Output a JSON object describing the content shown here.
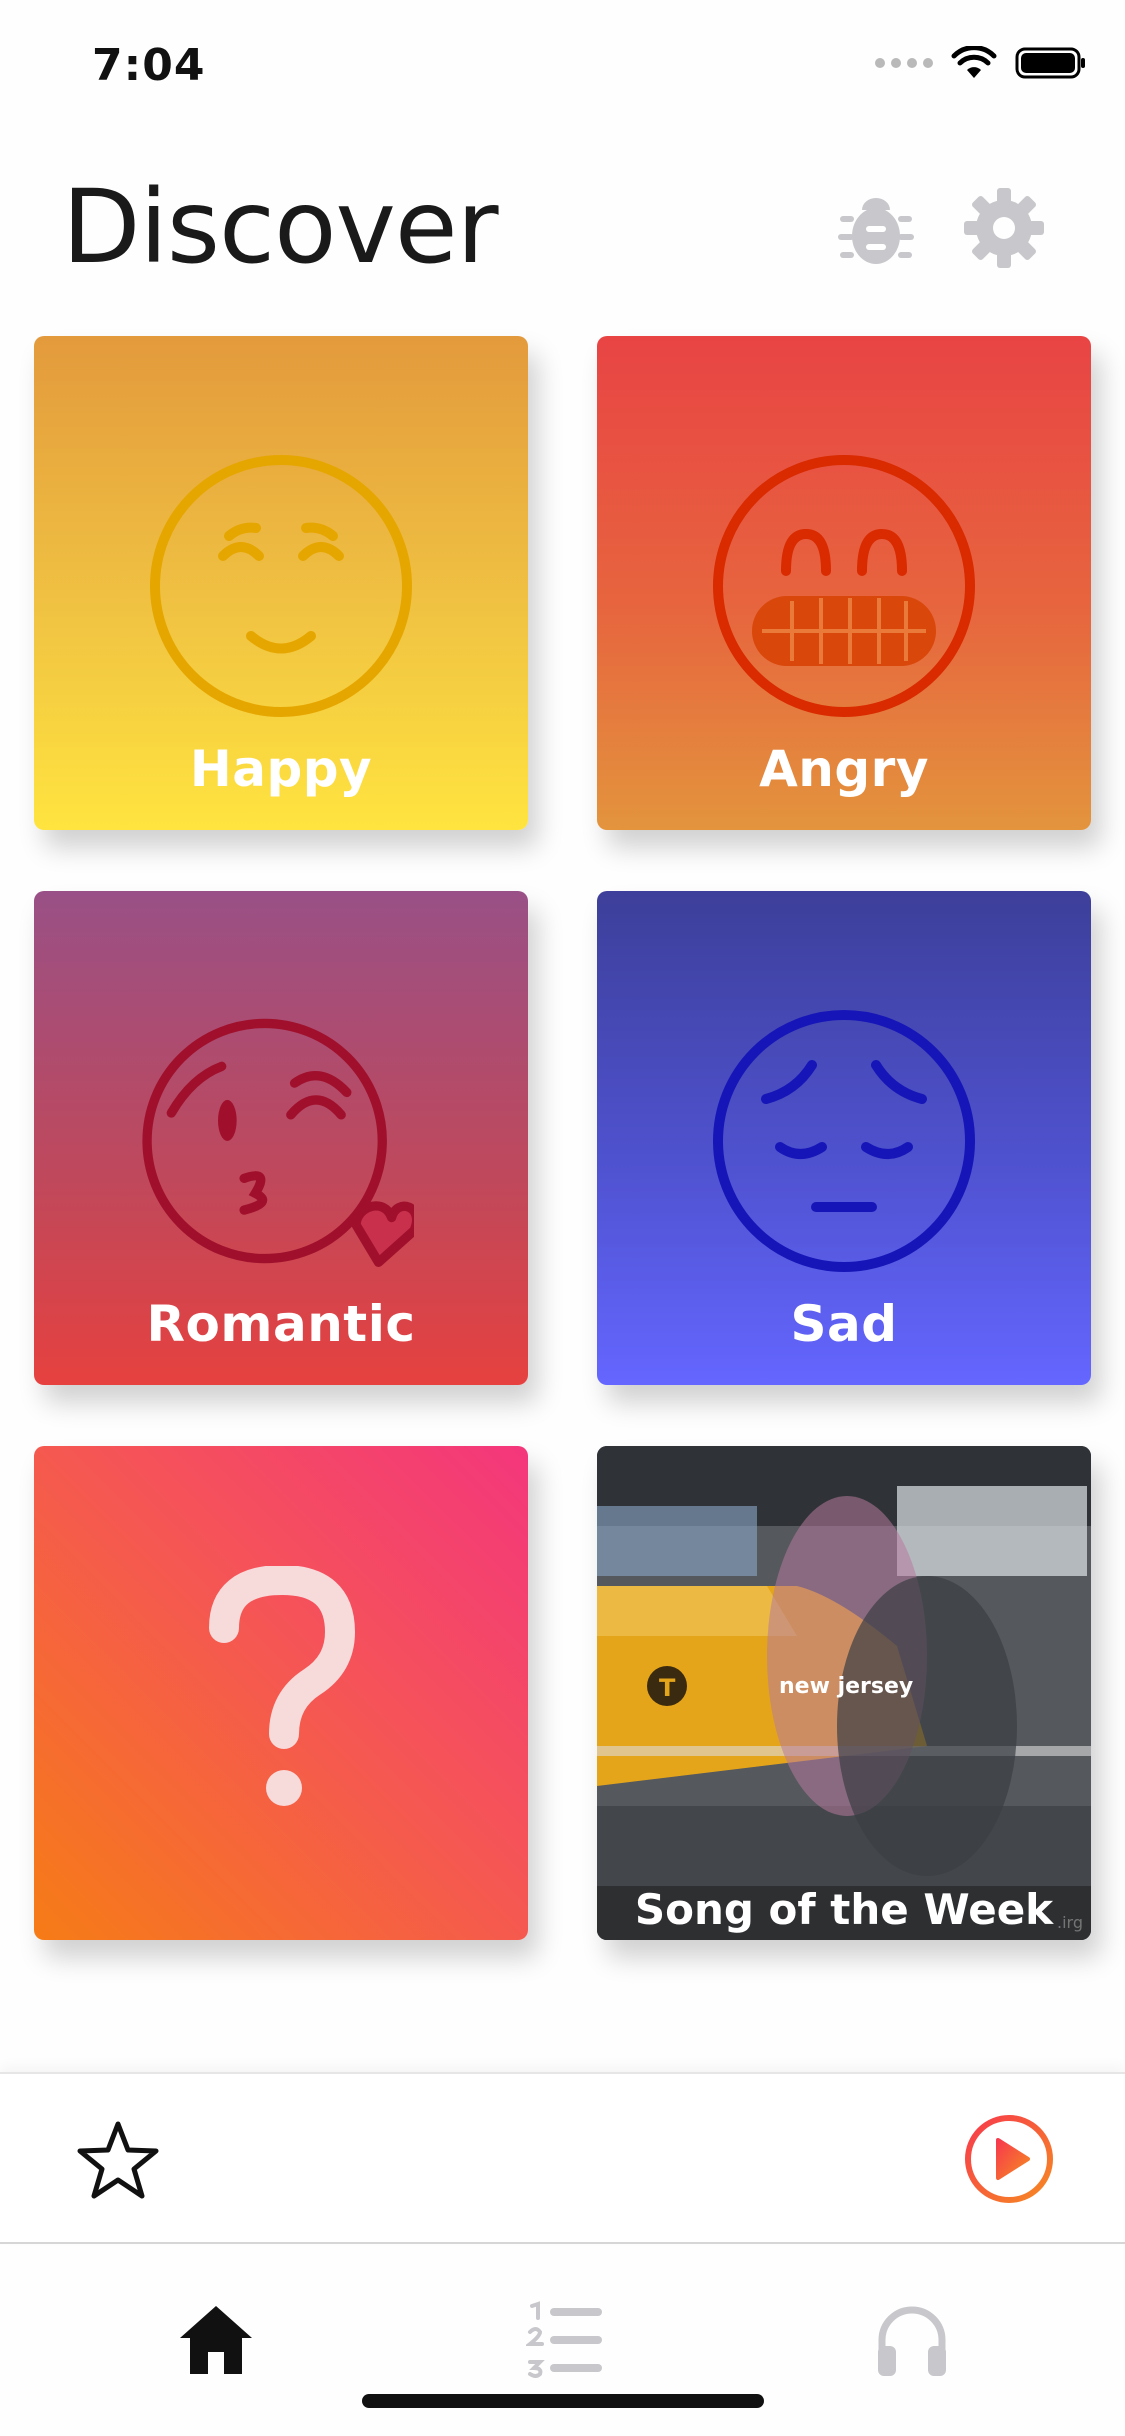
{
  "status_bar": {
    "time": "7:04"
  },
  "header": {
    "title": "Discover",
    "icons": [
      "bug-icon",
      "gear-icon"
    ]
  },
  "tiles": [
    {
      "label": "Happy",
      "icon": "smile-face-icon"
    },
    {
      "label": "Angry",
      "icon": "grimace-face-icon"
    },
    {
      "label": "Romantic",
      "icon": "kiss-face-icon"
    },
    {
      "label": "Sad",
      "icon": "sad-face-icon"
    },
    {
      "label": "",
      "icon": "question-mark-icon"
    },
    {
      "label": "Song of the Week",
      "image_caption": "new jersey"
    }
  ],
  "player_bar": {
    "favorite_icon": "star-icon",
    "play_icon": "play-icon"
  },
  "tab_bar": [
    "home-icon",
    "numbered-list-icon",
    "headphones-icon"
  ],
  "colors": {
    "accent_orange": "#f6602d",
    "icon_grey": "#c8c8cc"
  }
}
